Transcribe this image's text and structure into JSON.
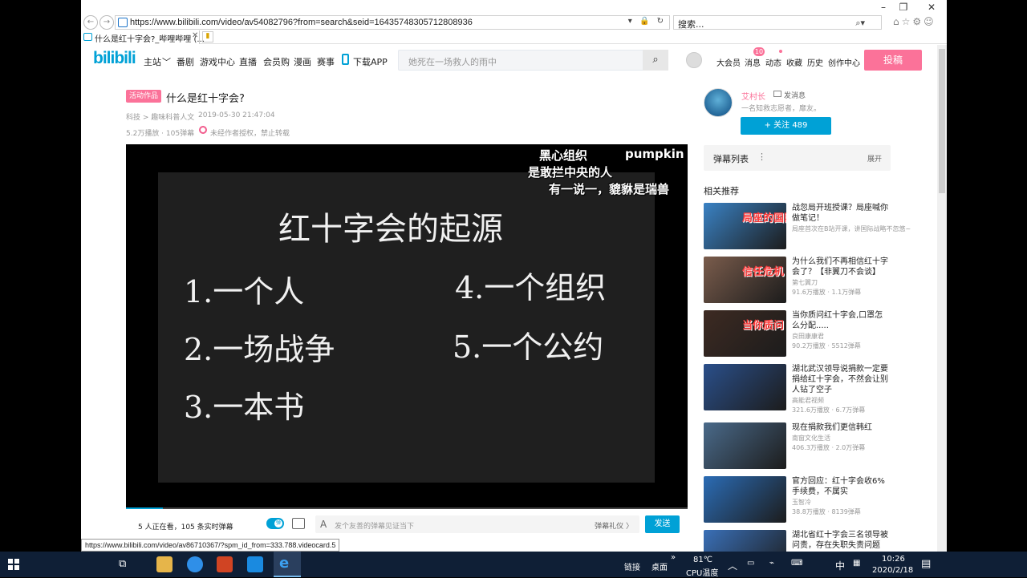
{
  "browser": {
    "url": "https://www.bilibili.com/video/av54082796?from=search&seid=16435748305712808936",
    "search_placeholder": "搜索...",
    "tab_title": "什么是红十字会?_哔哩哔哩 (...",
    "status_url": "https://www.bilibili.com/video/av86710367/?spm_id_from=333.788.videocard.5"
  },
  "header": {
    "logo": "bilibili",
    "nav": [
      "主站",
      "番剧",
      "游戏中心",
      "直播",
      "会员购",
      "漫画",
      "赛事",
      "下载APP"
    ],
    "search_placeholder": "她死在一场救人的雨中",
    "user_nav": [
      "大会员",
      "消息",
      "动态",
      "收藏",
      "历史",
      "创作中心"
    ],
    "message_badge": "10",
    "upload_label": "投稿"
  },
  "video": {
    "tag": "活动作品",
    "title": "什么是红十字会?",
    "category": "科技 > 趣味科普人文",
    "date": "2019-05-30 21:47:04",
    "views": "5.2万播放 · 105弹幕",
    "copyright": "未经作者授权，禁止转载",
    "progress_fraction": 0.066
  },
  "slide": {
    "title": "红十字会的起源",
    "items": [
      "1.一个人",
      "2.一场战争",
      "3.一本书",
      "4.一个组织",
      "5.一个公约"
    ]
  },
  "danmaku": [
    "黑心组织",
    "pumpkin",
    "是敢拦中央的人",
    "有一说一，貔貅是瑞兽"
  ],
  "danmaku_bar": {
    "count": "5 人正在看，105 条实时弹幕",
    "toggle_label": "弹",
    "placeholder": "发个友善的弹幕见证当下",
    "etiquette": "弹幕礼仪 〉",
    "send": "发送"
  },
  "uploader": {
    "name": "艾村长",
    "message": "发消息",
    "desc": "一名知救志愿者，靡友。",
    "follow": "+  关注 489"
  },
  "danmaku_list": {
    "label": "弹幕列表",
    "expand": "展开"
  },
  "recommend": {
    "title": "相关推荐",
    "items": [
      {
        "title": "战忽局开班授课？局座喊你做笔记！",
        "author": "局座首次在B站开课，讲国际战略不忽悠~",
        "stats": "",
        "thumb": "局座的国际战略课",
        "color": "#3a82c4"
      },
      {
        "title": "为什么我们不再相信红十字会了？【非翼刀不会谈】",
        "author": "第七翼刀",
        "stats": "91.6万播放 · 1.1万弹幕",
        "thumb": "信任危机",
        "color": "#7a5c4c"
      },
      {
        "title": "当你质问红十字会,口罩怎么分配.....",
        "author": "良田康康君",
        "stats": "90.2万播放 · 5512弹幕",
        "thumb": "当你质问 红十字会",
        "color": "#3d2a22"
      },
      {
        "title": "湖北武汉领导说捐款一定要捐给红十字会，不然会让别人钻了空子",
        "author": "高能君视频",
        "stats": "321.6万播放 · 6.7万弹幕",
        "thumb": "",
        "color": "#2a4f8a"
      },
      {
        "title": "现在捐款我们更信韩红",
        "author": "南窗文化生活",
        "stats": "406.3万播放 · 2.0万弹幕",
        "thumb": "",
        "color": "#4a6a8a"
      },
      {
        "title": "官方回应：红十字会收6%手续费，不属实",
        "author": "玉智冷",
        "stats": "38.8万播放 · 8139弹幕",
        "thumb": "",
        "color": "#2b6cb5"
      },
      {
        "title": "湖北省红十字会三名领导被问责，存在失职失责问题",
        "author": "",
        "stats": "",
        "thumb": "",
        "color": "#3a70b8"
      }
    ]
  },
  "taskbar": {
    "tray": [
      "链接",
      "桌面"
    ],
    "temp": "81℃",
    "temp_label": "CPU温度",
    "ime": "中",
    "time": "10:26",
    "date": "2020/2/18"
  }
}
